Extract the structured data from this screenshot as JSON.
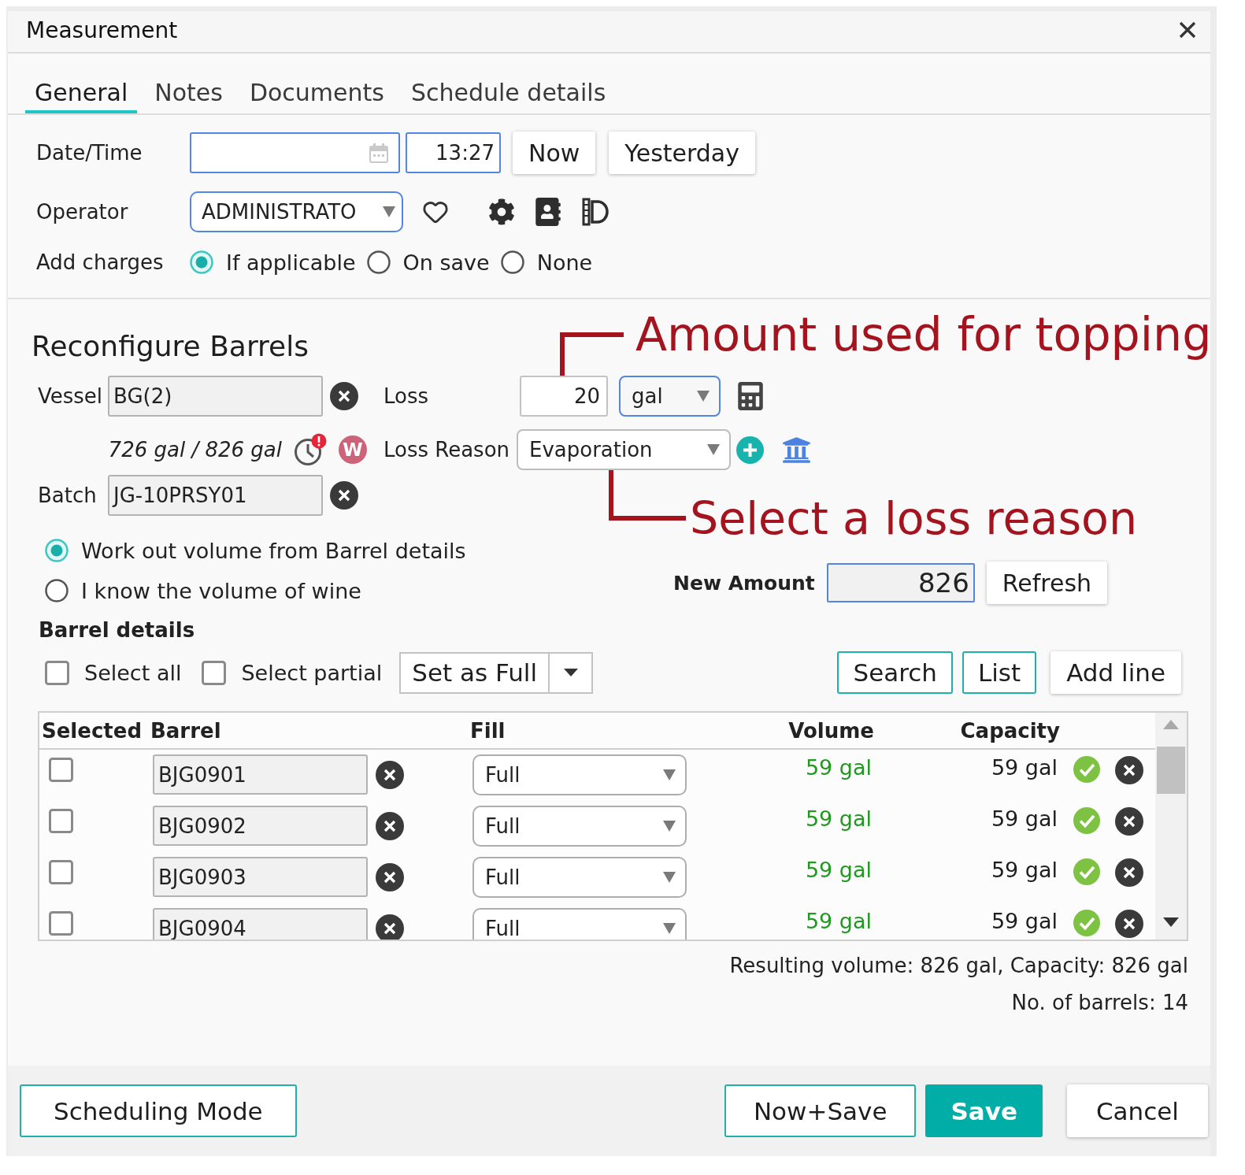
{
  "window": {
    "title": "Measurement"
  },
  "tabs": [
    {
      "label": "General",
      "selected": true
    },
    {
      "label": "Notes",
      "selected": false
    },
    {
      "label": "Documents",
      "selected": false
    },
    {
      "label": "Schedule details",
      "selected": false
    }
  ],
  "general": {
    "date_time": {
      "label": "Date/Time",
      "time": "13:27",
      "buttons": [
        "Now",
        "Yesterday"
      ]
    },
    "operator": {
      "label": "Operator",
      "value": "ADMINISTRATO"
    },
    "add_charges": {
      "label": "Add charges",
      "options": [
        {
          "label": "If applicable",
          "selected": true
        },
        {
          "label": "On save",
          "selected": false
        },
        {
          "label": "None",
          "selected": false
        }
      ]
    }
  },
  "reconfigure": {
    "title": "Reconfigure Barrels",
    "vessel": {
      "label": "Vessel",
      "value": "BG(2)"
    },
    "volume": "726 gal / 826 gal",
    "badge": "W",
    "batch": {
      "label": "Batch",
      "value": "JG-10PRSY01"
    },
    "loss": {
      "label": "Loss",
      "value": "20",
      "unit": "gal"
    },
    "loss_reason": {
      "label": "Loss Reason",
      "value": "Evaporation"
    },
    "volume_mode": [
      {
        "label": "Work out volume from Barrel details",
        "selected": true
      },
      {
        "label": "I know the volume of wine",
        "selected": false
      }
    ],
    "new_amount": {
      "label": "New Amount",
      "value": "826",
      "button": "Refresh"
    }
  },
  "barrel_details": {
    "title": "Barrel details",
    "select_all": {
      "label": "Select all",
      "checked": false
    },
    "select_partial": {
      "label": "Select partial",
      "checked": false
    },
    "set_action": "Set as Full",
    "buttons": [
      {
        "label": "Search",
        "kind": "outlined"
      },
      {
        "label": "List",
        "kind": "outlined"
      },
      {
        "label": "Add line",
        "kind": "plain"
      }
    ],
    "table": {
      "columns": [
        "Selected",
        "Barrel",
        "Fill",
        "Volume",
        "Capacity"
      ],
      "rows": [
        {
          "checked": false,
          "barrel": "BJG0901",
          "fill": "Full",
          "volume": "59 gal",
          "capacity": "59 gal"
        },
        {
          "checked": false,
          "barrel": "BJG0902",
          "fill": "Full",
          "volume": "59 gal",
          "capacity": "59 gal"
        },
        {
          "checked": false,
          "barrel": "BJG0903",
          "fill": "Full",
          "volume": "59 gal",
          "capacity": "59 gal"
        },
        {
          "checked": false,
          "barrel": "BJG0904",
          "fill": "Full",
          "volume": "59 gal",
          "capacity": "59 gal"
        }
      ]
    },
    "summary": [
      "Resulting volume: 826 gal, Capacity: 826 gal",
      "No. of barrels: 14"
    ]
  },
  "annotations": [
    {
      "text": "Amount used for topping"
    },
    {
      "text": "Select a loss reason"
    }
  ],
  "footer": {
    "buttons": [
      {
        "label": "Scheduling Mode",
        "kind": "outlined"
      },
      {
        "label": "Now+Save",
        "kind": "outlined"
      },
      {
        "label": "Save",
        "kind": "primary"
      },
      {
        "label": "Cancel",
        "kind": "plain"
      }
    ]
  }
}
